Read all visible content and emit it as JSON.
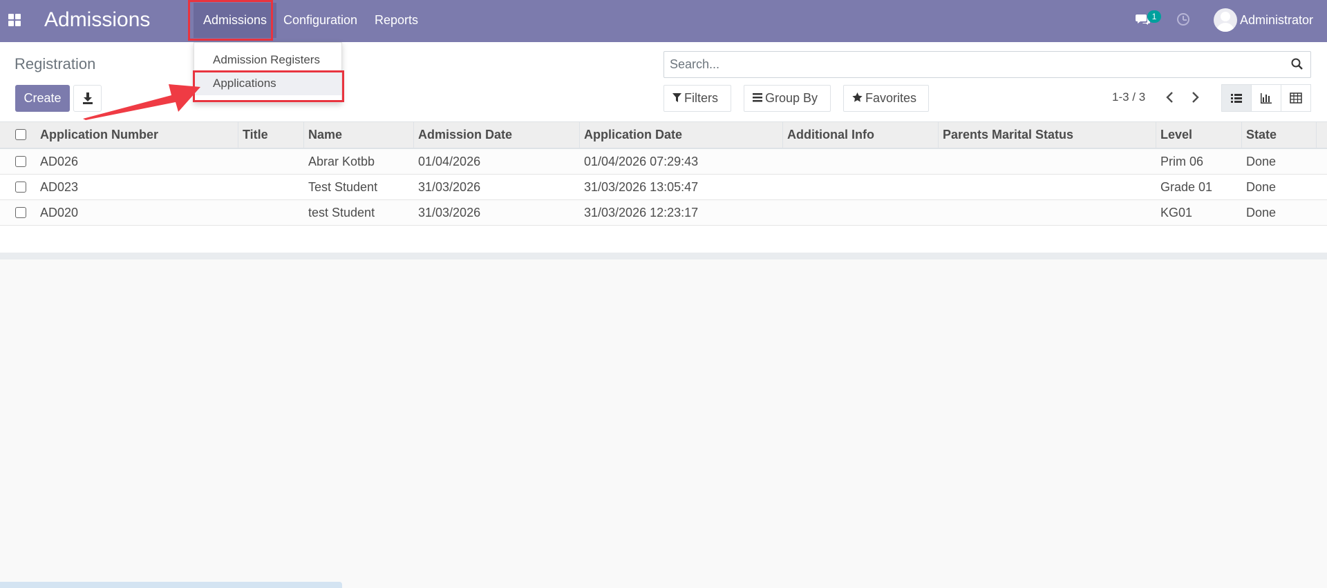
{
  "navbar": {
    "brand": "Admissions",
    "menu": [
      "Admissions",
      "Configuration",
      "Reports"
    ],
    "chat_badge": "1",
    "user_name": "Administrator"
  },
  "dropdown": {
    "items": [
      "Admission Registers",
      "Applications"
    ]
  },
  "control_panel": {
    "title": "Registration",
    "create_label": "Create",
    "search_placeholder": "Search...",
    "filters_label": "Filters",
    "groupby_label": "Group By",
    "favorites_label": "Favorites",
    "pager": "1-3 / 3"
  },
  "table": {
    "columns": [
      "Application Number",
      "Title",
      "Name",
      "Admission Date",
      "Application Date",
      "Additional Info",
      "Parents Marital Status",
      "Level",
      "State"
    ],
    "rows": [
      {
        "number": "AD026",
        "title": "",
        "name": "Abrar Kotbb",
        "admission_date": "01/04/2026",
        "application_date": "01/04/2026 07:29:43",
        "info": "",
        "marital": "",
        "level": "Prim 06",
        "state": "Done"
      },
      {
        "number": "AD023",
        "title": "",
        "name": "Test Student",
        "admission_date": "31/03/2026",
        "application_date": "31/03/2026 13:05:47",
        "info": "",
        "marital": "",
        "level": "Grade 01",
        "state": "Done"
      },
      {
        "number": "AD020",
        "title": "",
        "name": "test Student",
        "admission_date": "31/03/2026",
        "application_date": "31/03/2026 12:23:17",
        "info": "",
        "marital": "",
        "level": "KG01",
        "state": "Done"
      }
    ]
  },
  "colors": {
    "brand": "#7c7bad",
    "highlight": "#e8343f",
    "badge": "#00a09d"
  }
}
